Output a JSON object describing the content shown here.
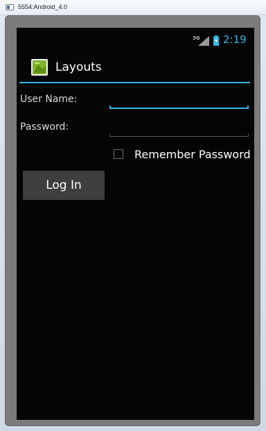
{
  "window": {
    "title": "5554:Android_4.0",
    "app_icon": "emulator-window-icon"
  },
  "status_bar": {
    "network_type": "3G",
    "signal_icon": "cell-signal-icon",
    "battery_icon": "battery-charging-icon",
    "time": "2:19"
  },
  "action_bar": {
    "app_icon": "android-app-icon",
    "title": "Layouts"
  },
  "form": {
    "username_label": "User Name:",
    "username_value": "",
    "password_label": "Password:",
    "password_value": "",
    "remember_label": "Remember Password",
    "remember_checked": false,
    "login_label": "Log In"
  },
  "colors": {
    "accent": "#33b5e5",
    "screen_background": "#050505",
    "button_background": "#3e3e3e",
    "emulator_frame": "#7b7b7b"
  }
}
